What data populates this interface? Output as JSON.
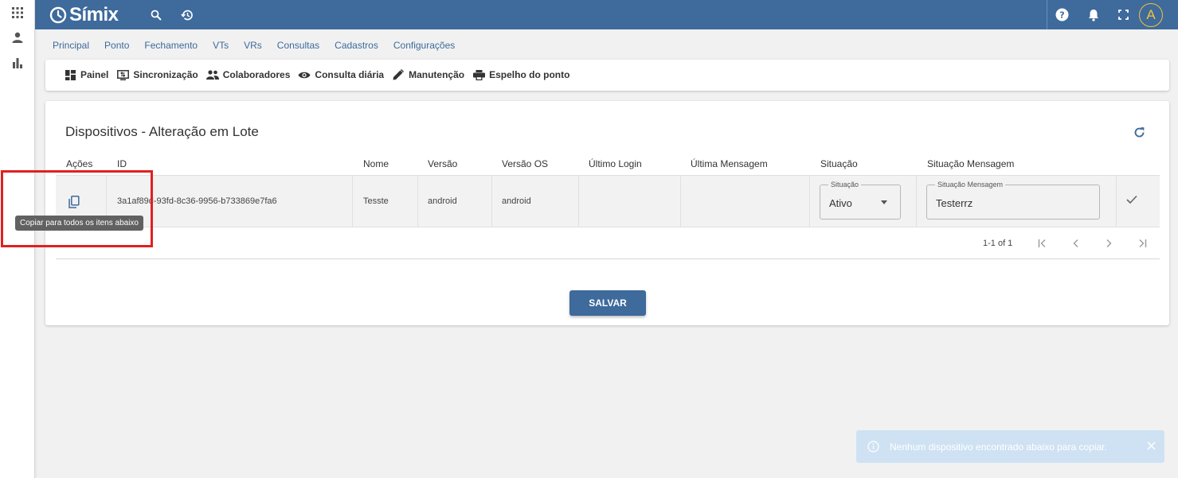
{
  "app": {
    "name": "Símix"
  },
  "topbar": {
    "icons": [
      "search-icon",
      "history-icon",
      "help-icon",
      "notifications-icon",
      "fullscreen-icon"
    ],
    "avatar_letter": "A"
  },
  "rail": {
    "icons": [
      "apps-grid-icon",
      "person-icon",
      "bar-chart-icon"
    ]
  },
  "nav": {
    "items": [
      "Principal",
      "Ponto",
      "Fechamento",
      "VTs",
      "VRs",
      "Consultas",
      "Cadastros",
      "Configurações"
    ]
  },
  "subnav": {
    "items": [
      {
        "label": "Painel",
        "icon": "dashboard-icon"
      },
      {
        "label": "Sincronização",
        "icon": "sync-screen-icon"
      },
      {
        "label": "Colaboradores",
        "icon": "people-icon"
      },
      {
        "label": "Consulta diária",
        "icon": "eye-icon"
      },
      {
        "label": "Manutenção",
        "icon": "pencil-icon"
      },
      {
        "label": "Espelho do ponto",
        "icon": "printer-icon"
      }
    ]
  },
  "card": {
    "title": "Dispositivos - Alteração em Lote",
    "columns": [
      "Ações",
      "ID",
      "Nome",
      "Versão",
      "Versão OS",
      "Último Login",
      "Última Mensagem",
      "Situação",
      "Situação Mensagem"
    ],
    "rows": [
      {
        "id": "3a1af89d-93fd-8c36-9956-b733869e7fa6",
        "nome": "Tesste",
        "versao": "android",
        "versao_os": "android",
        "ultimo_login": "",
        "ultima_mensagem": "",
        "situacao_label": "Situação",
        "situacao_value": "Ativo",
        "situacao_msg_label": "Situação Mensagem",
        "situacao_msg_value": "Testerrz"
      }
    ],
    "pager_range": "1-1 of 1",
    "save_label": "SALVAR"
  },
  "tooltip": {
    "text": "Copiar para todos os itens abaixo"
  },
  "toast": {
    "text": "Nenhum dispositivo encontrado abaixo para copiar."
  },
  "colors": {
    "primary": "#3e6a9c",
    "highlight": "#e0201f",
    "toast_bg": "#cfe2f3",
    "avatar_accent": "#f2c33a"
  }
}
